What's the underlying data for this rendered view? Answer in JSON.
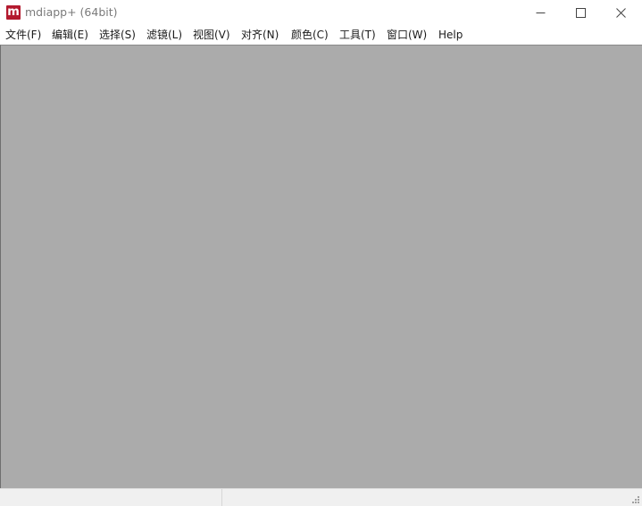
{
  "window": {
    "title": "mdiapp+ (64bit)",
    "icon_letter": "m",
    "icon_color": "#b3192e"
  },
  "menubar": {
    "items": [
      {
        "label": "文件(F)"
      },
      {
        "label": "编辑(E)"
      },
      {
        "label": "选择(S)"
      },
      {
        "label": "滤镜(L)"
      },
      {
        "label": "视图(V)"
      },
      {
        "label": "对齐(N)"
      },
      {
        "label": "颜色(C)"
      },
      {
        "label": "工具(T)"
      },
      {
        "label": "窗口(W)"
      },
      {
        "label": "Help"
      }
    ]
  },
  "workspace": {
    "background_color": "#ababab"
  },
  "statusbar": {
    "pane1_text": "",
    "pane2_text": ""
  }
}
